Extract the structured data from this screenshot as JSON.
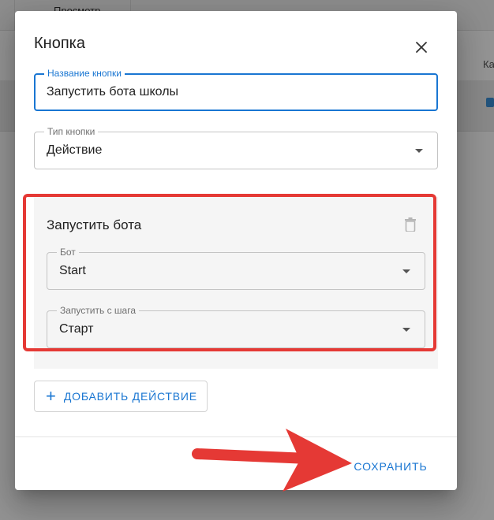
{
  "background": {
    "tab2_label": "Просмотр",
    "col_label": "Ка"
  },
  "dialog": {
    "title": "Кнопка",
    "close_icon": "close-icon"
  },
  "button_name": {
    "label": "Название кнопки",
    "value": "Запустить бота школы"
  },
  "button_type": {
    "label": "Тип кнопки",
    "value": "Действие"
  },
  "action": {
    "title": "Запустить бота",
    "delete_icon": "trash-icon",
    "bot": {
      "label": "Бот",
      "value": "Start"
    },
    "start_step": {
      "label": "Запустить с шага",
      "value": "Старт"
    }
  },
  "add_action": {
    "label": "ДОБАВИТЬ ДЕЙСТВИЕ"
  },
  "footer": {
    "save_label": "СОХРАНИТЬ"
  },
  "colors": {
    "accent": "#1976d2",
    "highlight": "#e53935"
  }
}
